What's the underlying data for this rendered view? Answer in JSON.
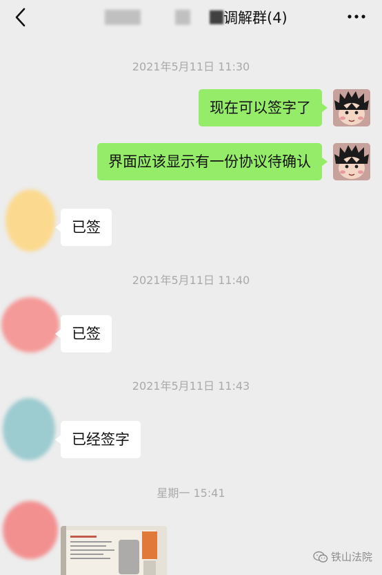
{
  "header": {
    "title": "调解群(4)",
    "back_icon": "chevron-left-icon",
    "more_icon": "more-dots-icon"
  },
  "colors": {
    "background": "#ededed",
    "my_bubble": "#95ec69",
    "other_bubble": "#ffffff",
    "timestamp": "#a9a9a9"
  },
  "messages": [
    {
      "type": "time",
      "text": "2021年5月11日 11:30"
    },
    {
      "type": "msg",
      "side": "right",
      "text": "现在可以签字了"
    },
    {
      "type": "msg",
      "side": "right",
      "text": "界面应该显示有一份协议待确认"
    },
    {
      "type": "msg",
      "side": "left",
      "text": "已签"
    },
    {
      "type": "time",
      "text": "2021年5月11日 11:40"
    },
    {
      "type": "msg",
      "side": "left",
      "text": "已签"
    },
    {
      "type": "time",
      "text": "2021年5月11日 11:43"
    },
    {
      "type": "msg",
      "side": "left",
      "text": "已经签字"
    },
    {
      "type": "time",
      "text": "星期一 15:41"
    },
    {
      "type": "image",
      "side": "left"
    }
  ],
  "watermark": {
    "text": "铁山法院"
  }
}
